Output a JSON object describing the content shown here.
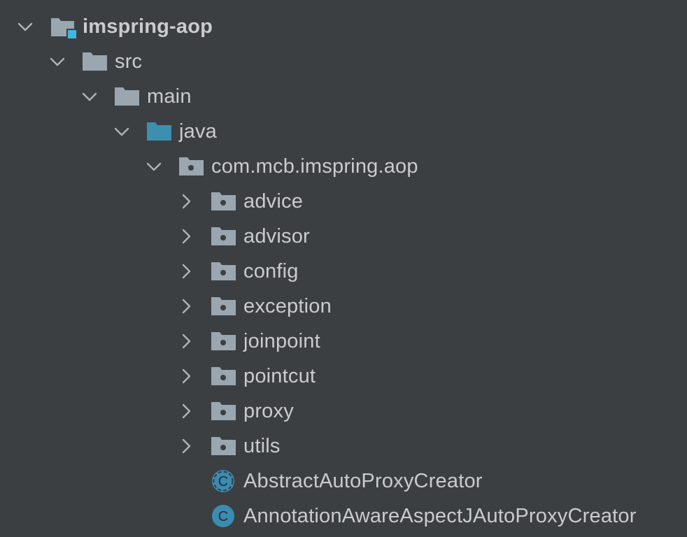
{
  "project_tree": {
    "root": {
      "label": "imspring-aop",
      "icon": "module-folder-icon",
      "expanded": true
    },
    "src": {
      "label": "src",
      "icon": "folder-icon",
      "expanded": true
    },
    "main": {
      "label": "main",
      "icon": "folder-icon",
      "expanded": true
    },
    "java": {
      "label": "java",
      "icon": "source-root-folder-icon",
      "expanded": true
    },
    "package": {
      "label": "com.mcb.imspring.aop",
      "icon": "package-icon",
      "expanded": true
    },
    "subpackages": [
      {
        "label": "advice",
        "icon": "package-icon",
        "expanded": false
      },
      {
        "label": "advisor",
        "icon": "package-icon",
        "expanded": false
      },
      {
        "label": "config",
        "icon": "package-icon",
        "expanded": false
      },
      {
        "label": "exception",
        "icon": "package-icon",
        "expanded": false
      },
      {
        "label": "joinpoint",
        "icon": "package-icon",
        "expanded": false
      },
      {
        "label": "pointcut",
        "icon": "package-icon",
        "expanded": false
      },
      {
        "label": "proxy",
        "icon": "package-icon",
        "expanded": false
      },
      {
        "label": "utils",
        "icon": "package-icon",
        "expanded": false
      }
    ],
    "classes": [
      {
        "label": "AbstractAutoProxyCreator",
        "icon": "abstract-class-icon",
        "glyph": "C"
      },
      {
        "label": "AnnotationAwareAspectJAutoProxyCreator",
        "icon": "class-icon",
        "glyph": "C"
      }
    ],
    "colors": {
      "background": "#3c3f41",
      "text": "#c9cbcd",
      "folder": "#9aa7b0",
      "source_root_folder": "#3d8fb0",
      "module_badge": "#40b6e0",
      "class_icon": "#3a8cb3"
    }
  }
}
